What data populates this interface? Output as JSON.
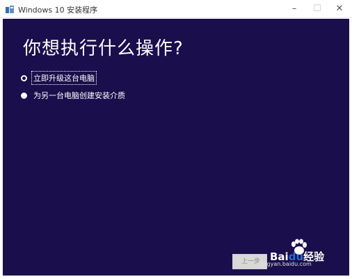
{
  "window": {
    "title": "Windows 10 安装程序",
    "minimize_glyph": "–",
    "maximize_glyph": "☐",
    "close_glyph": "✕",
    "icons": {
      "app": "windows-setup-icon"
    }
  },
  "main": {
    "heading": "你想执行什么操作?",
    "background_color": "#1a0f4c",
    "options": [
      {
        "label": "立即升级这台电脑",
        "selected": true
      },
      {
        "label": "为另一台电脑创建安装介质",
        "selected": false
      }
    ]
  },
  "footer": {
    "back_label": "上一步"
  },
  "watermark": {
    "brand_text": "Bai",
    "brand_text_2": "du",
    "brand_suffix": "经验",
    "url": "jingyan.baidu.com"
  }
}
